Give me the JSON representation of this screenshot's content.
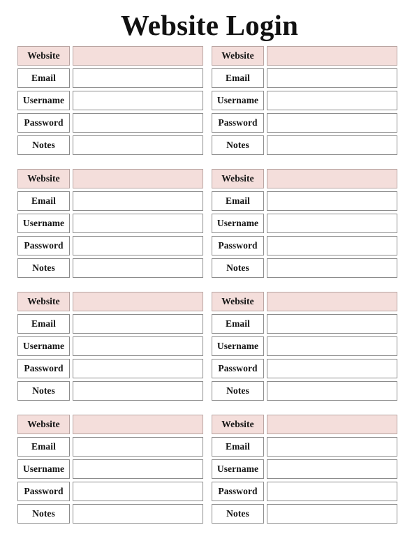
{
  "document": {
    "title": "Website Login",
    "background_color": "#ffffff",
    "text_color": "#1a1a1a"
  },
  "theme": {
    "highlight_fill": "#f4dedb",
    "highlight_border": "#b9a5a2",
    "cell_border": "#8c8c8c",
    "cell_fill": "#ffffff"
  },
  "field_labels": {
    "website": "Website",
    "email": "Email",
    "username": "Username",
    "password": "Password",
    "notes": "Notes"
  },
  "entries": [
    {
      "fields": [
        {
          "label": "Website",
          "value": "",
          "highlight": true
        },
        {
          "label": "Email",
          "value": "",
          "highlight": false
        },
        {
          "label": "Username",
          "value": "",
          "highlight": false
        },
        {
          "label": "Password",
          "value": "",
          "highlight": false
        },
        {
          "label": "Notes",
          "value": "",
          "highlight": false
        }
      ]
    },
    {
      "fields": [
        {
          "label": "Website",
          "value": "",
          "highlight": true
        },
        {
          "label": "Email",
          "value": "",
          "highlight": false
        },
        {
          "label": "Username",
          "value": "",
          "highlight": false
        },
        {
          "label": "Password",
          "value": "",
          "highlight": false
        },
        {
          "label": "Notes",
          "value": "",
          "highlight": false
        }
      ]
    },
    {
      "fields": [
        {
          "label": "Website",
          "value": "",
          "highlight": true
        },
        {
          "label": "Email",
          "value": "",
          "highlight": false
        },
        {
          "label": "Username",
          "value": "",
          "highlight": false
        },
        {
          "label": "Password",
          "value": "",
          "highlight": false
        },
        {
          "label": "Notes",
          "value": "",
          "highlight": false
        }
      ]
    },
    {
      "fields": [
        {
          "label": "Website",
          "value": "",
          "highlight": true
        },
        {
          "label": "Email",
          "value": "",
          "highlight": false
        },
        {
          "label": "Username",
          "value": "",
          "highlight": false
        },
        {
          "label": "Password",
          "value": "",
          "highlight": false
        },
        {
          "label": "Notes",
          "value": "",
          "highlight": false
        }
      ]
    },
    {
      "fields": [
        {
          "label": "Website",
          "value": "",
          "highlight": true
        },
        {
          "label": "Email",
          "value": "",
          "highlight": false
        },
        {
          "label": "Username",
          "value": "",
          "highlight": false
        },
        {
          "label": "Password",
          "value": "",
          "highlight": false
        },
        {
          "label": "Notes",
          "value": "",
          "highlight": false
        }
      ]
    },
    {
      "fields": [
        {
          "label": "Website",
          "value": "",
          "highlight": true
        },
        {
          "label": "Email",
          "value": "",
          "highlight": false
        },
        {
          "label": "Username",
          "value": "",
          "highlight": false
        },
        {
          "label": "Password",
          "value": "",
          "highlight": false
        },
        {
          "label": "Notes",
          "value": "",
          "highlight": false
        }
      ]
    },
    {
      "fields": [
        {
          "label": "Website",
          "value": "",
          "highlight": true
        },
        {
          "label": "Email",
          "value": "",
          "highlight": false
        },
        {
          "label": "Username",
          "value": "",
          "highlight": false
        },
        {
          "label": "Password",
          "value": "",
          "highlight": false
        },
        {
          "label": "Notes",
          "value": "",
          "highlight": false
        }
      ]
    },
    {
      "fields": [
        {
          "label": "Website",
          "value": "",
          "highlight": true
        },
        {
          "label": "Email",
          "value": "",
          "highlight": false
        },
        {
          "label": "Username",
          "value": "",
          "highlight": false
        },
        {
          "label": "Password",
          "value": "",
          "highlight": false
        },
        {
          "label": "Notes",
          "value": "",
          "highlight": false
        }
      ]
    }
  ],
  "layout": {
    "columns": 2,
    "rows": 4
  }
}
